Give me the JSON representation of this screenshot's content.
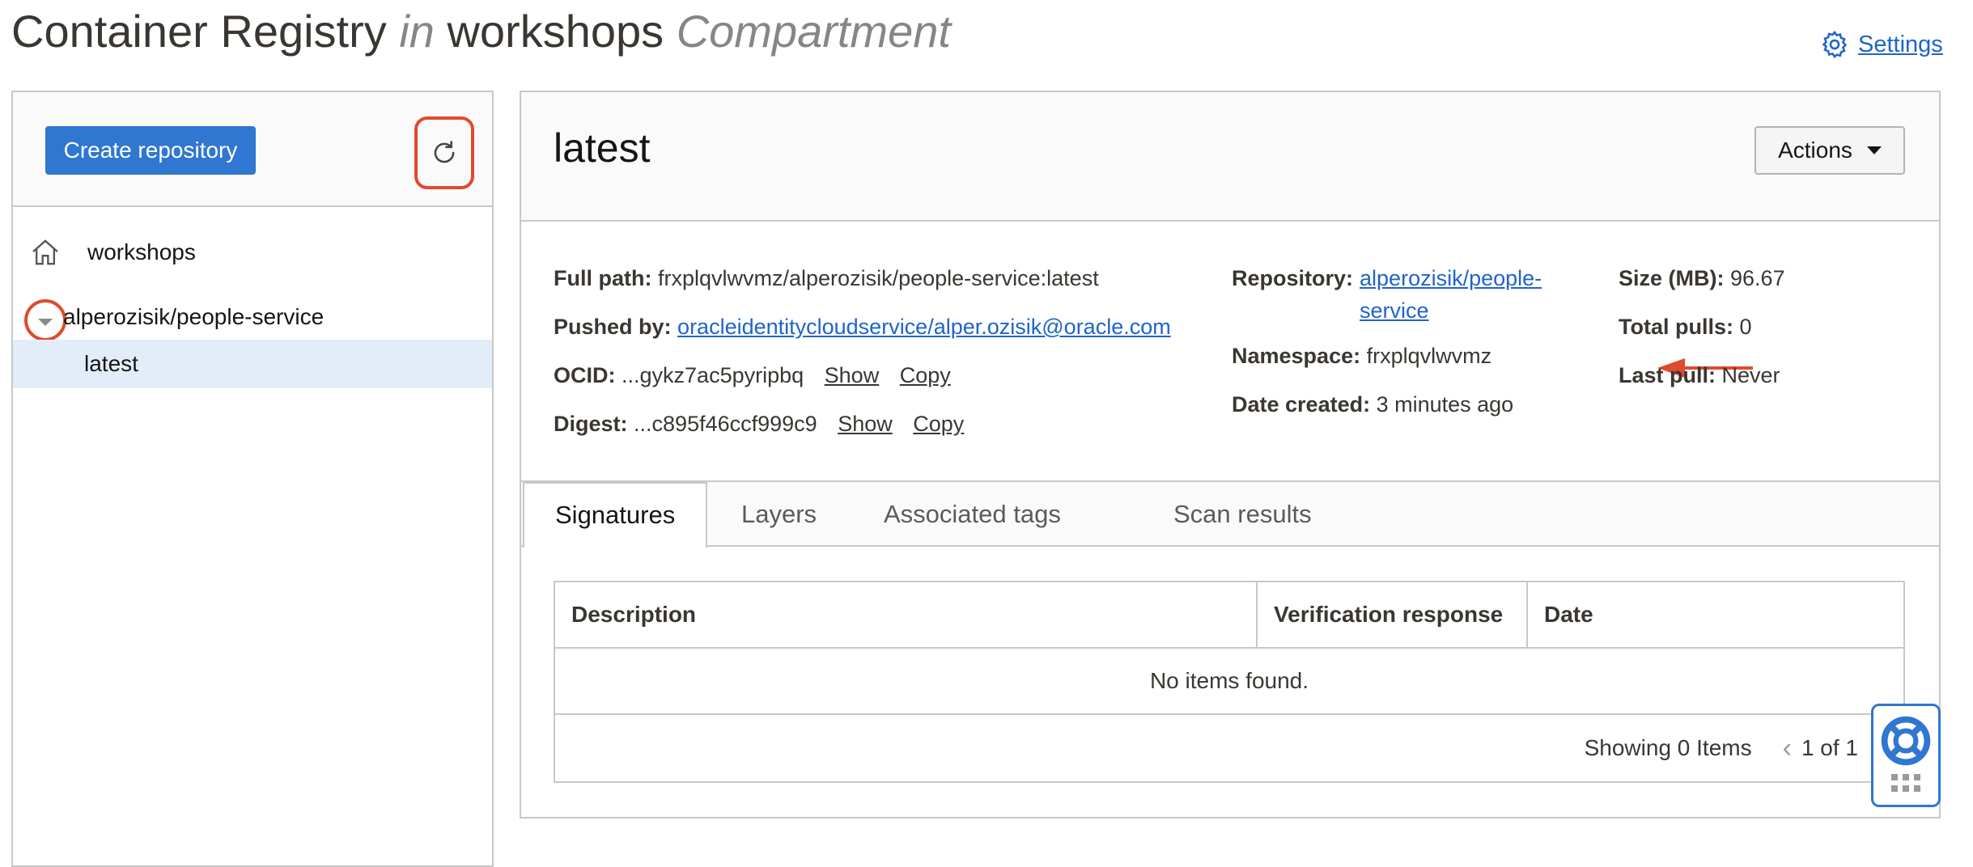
{
  "page": {
    "title_part1": "Container Registry",
    "title_in": "in",
    "title_compartment_name": "workshops",
    "title_compartment_word": "Compartment",
    "settings_label": "Settings"
  },
  "left": {
    "create_button": "Create repository",
    "tree": {
      "root": "workshops",
      "repository": "alperozisik/people-service",
      "image_tag": "latest"
    }
  },
  "detail": {
    "title": "latest",
    "actions_label": "Actions",
    "full_path_label": "Full path:",
    "full_path": "frxplqvlwvmz/alperozisik/people-service:latest",
    "pushed_by_label": "Pushed by:",
    "pushed_by": "oracleidentitycloudservice/alper.ozisik@oracle.com",
    "ocid_label": "OCID:",
    "ocid": "...gykz7ac5pyripbq",
    "digest_label": "Digest:",
    "digest": "...c895f46ccf999c9",
    "show_label": "Show",
    "copy_label": "Copy",
    "repository_label": "Repository:",
    "repository": "alperozisik/people-service",
    "namespace_label": "Namespace:",
    "namespace": "frxplqvlwvmz",
    "date_created_label": "Date created:",
    "date_created": "3 minutes ago",
    "size_label": "Size (MB):",
    "size": "96.67",
    "total_pulls_label": "Total pulls:",
    "total_pulls": "0",
    "last_pull_label": "Last pull:",
    "last_pull": "Never"
  },
  "tabs": [
    "Signatures",
    "Layers",
    "Associated tags",
    "Scan results"
  ],
  "table": {
    "columns": [
      "Description",
      "Verification response",
      "Date"
    ],
    "empty_text": "No items found.",
    "showing_text": "Showing 0 Items",
    "page_text": "1 of 1"
  },
  "colors": {
    "accent": "#2f77d0",
    "highlight": "#e04a2e",
    "selected_row": "#e3edf9"
  },
  "icons": [
    "gear-icon",
    "refresh-icon",
    "home-icon",
    "caret-down-icon",
    "arrow-left-icon",
    "chevron-left-icon",
    "lifebuoy-icon"
  ]
}
